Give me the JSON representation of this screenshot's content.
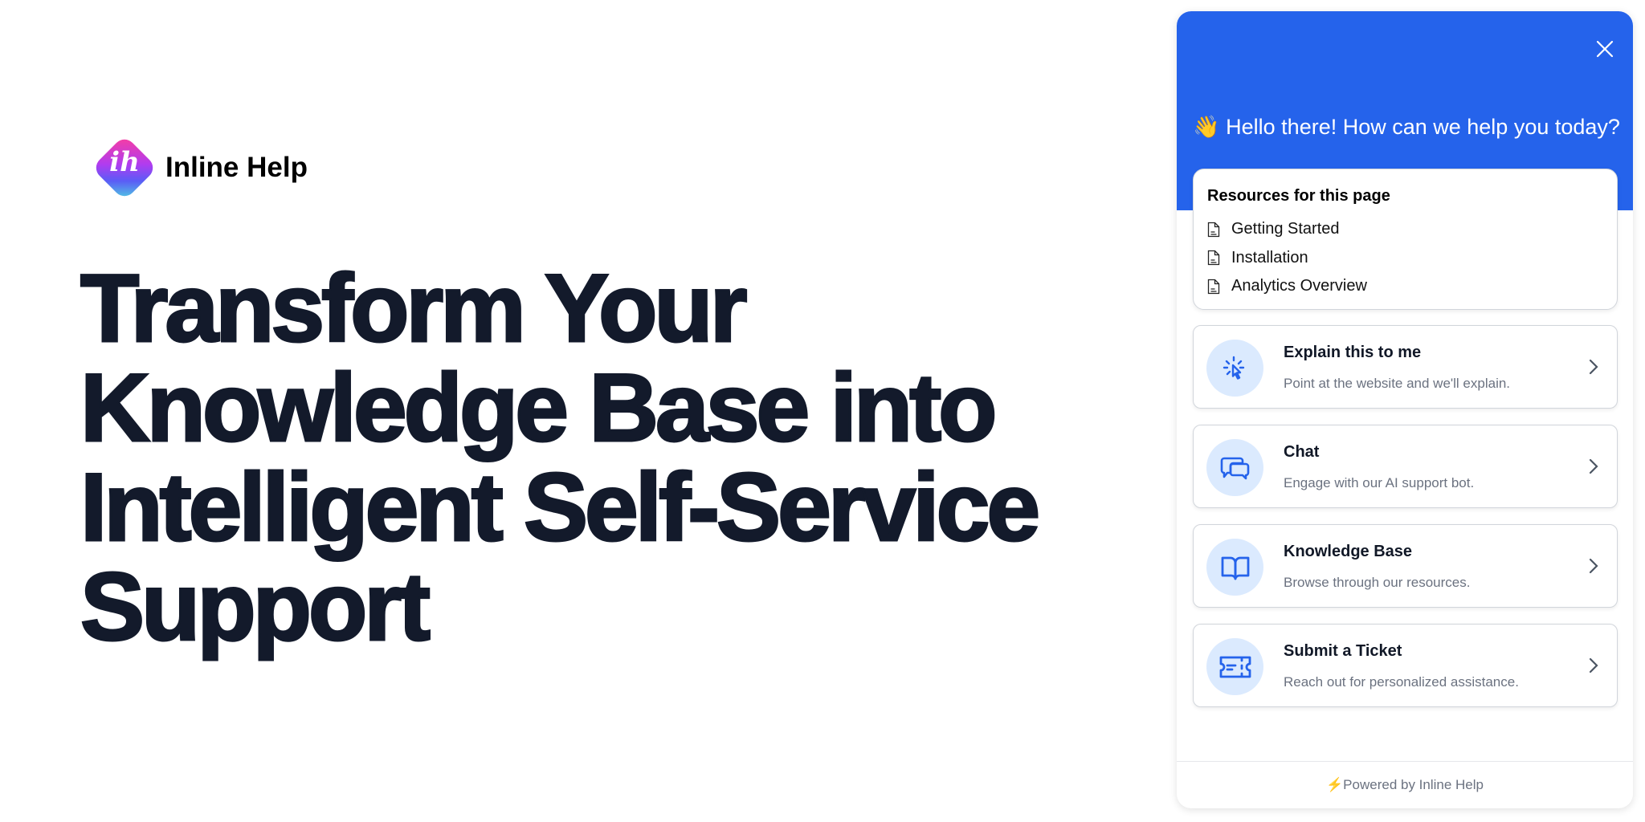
{
  "brand": {
    "name": "Inline Help",
    "logo_letters": "ih"
  },
  "hero": {
    "lines": [
      "Transform Your",
      "Knowledge Base into",
      "Intelligent Self-Service",
      "Support"
    ]
  },
  "widget": {
    "greeting_emoji": "👋",
    "greeting": "Hello there! How can we help you today?",
    "accent_color": "#2563eb",
    "resources": {
      "title": "Resources for this page",
      "items": [
        "Getting Started",
        "Installation",
        "Analytics Overview"
      ]
    },
    "options": [
      {
        "title": "Explain this to me",
        "subtitle": "Point at the website and we'll explain.",
        "icon": "cursor-click-icon"
      },
      {
        "title": "Chat",
        "subtitle": "Engage with our AI support bot.",
        "icon": "chat-bubbles-icon"
      },
      {
        "title": "Knowledge Base",
        "subtitle": "Browse through our resources.",
        "icon": "book-open-icon"
      },
      {
        "title": "Submit a Ticket",
        "subtitle": "Reach out for personalized assistance.",
        "icon": "ticket-icon"
      }
    ],
    "footer": {
      "bolt": "⚡",
      "text": "Powered by Inline Help"
    }
  }
}
